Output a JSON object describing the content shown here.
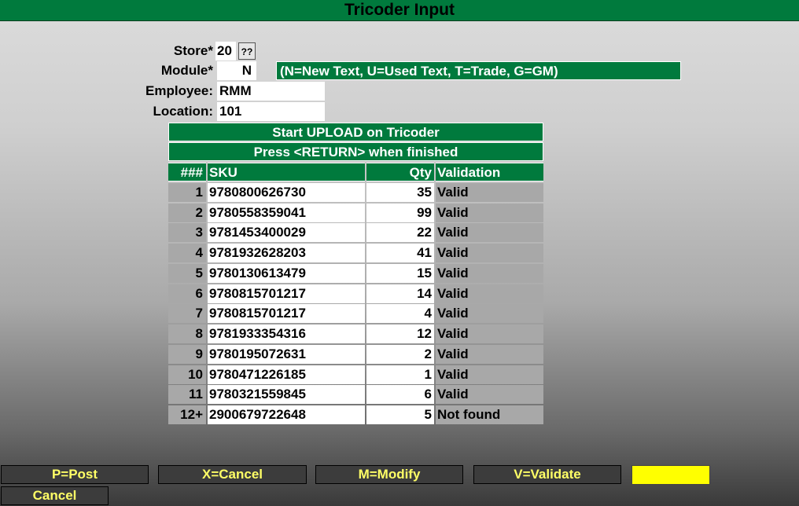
{
  "window": {
    "title": "Tricoder Input"
  },
  "form": {
    "store_label": "Store*",
    "store_value": "20",
    "lookup_button": "??",
    "module_label": "Module*",
    "module_value": "N",
    "module_hint": "(N=New Text, U=Used Text, T=Trade, G=GM)",
    "employee_label": "Employee:",
    "employee_value": "RMM",
    "location_label": "Location:",
    "location_value": "101"
  },
  "upload": {
    "banner1": "Start UPLOAD on Tricoder",
    "banner2": "Press <RETURN> when finished"
  },
  "table": {
    "headers": {
      "num": "###",
      "sku": "SKU",
      "qty": "Qty",
      "validation": "Validation"
    },
    "rows": [
      {
        "num": "1",
        "sku": "9780800626730",
        "qty": "35",
        "validation": "Valid"
      },
      {
        "num": "2",
        "sku": "9780558359041",
        "qty": "99",
        "validation": "Valid"
      },
      {
        "num": "3",
        "sku": "9781453400029",
        "qty": "22",
        "validation": "Valid"
      },
      {
        "num": "4",
        "sku": "9781932628203",
        "qty": "41",
        "validation": "Valid"
      },
      {
        "num": "5",
        "sku": "9780130613479",
        "qty": "15",
        "validation": "Valid"
      },
      {
        "num": "6",
        "sku": "9780815701217",
        "qty": "14",
        "validation": "Valid"
      },
      {
        "num": "7",
        "sku": "9780815701217",
        "qty": "4",
        "validation": "Valid"
      },
      {
        "num": "8",
        "sku": "9781933354316",
        "qty": "12",
        "validation": "Valid"
      },
      {
        "num": "9",
        "sku": "9780195072631",
        "qty": "2",
        "validation": "Valid"
      },
      {
        "num": "10",
        "sku": "9780471226185",
        "qty": "1",
        "validation": "Valid"
      },
      {
        "num": "11",
        "sku": "9780321559845",
        "qty": "6",
        "validation": "Valid"
      },
      {
        "num": "12+",
        "sku": "2900679722648",
        "qty": "5",
        "validation": "Not found"
      }
    ]
  },
  "fkeys": {
    "post": "P=Post",
    "cancel_x": "X=Cancel",
    "modify": "M=Modify",
    "validate": "V=Validate",
    "cancel": "Cancel"
  },
  "colors": {
    "accent": "#007a3d",
    "fkey_text": "#ffff66",
    "highlight": "#ffff00"
  }
}
